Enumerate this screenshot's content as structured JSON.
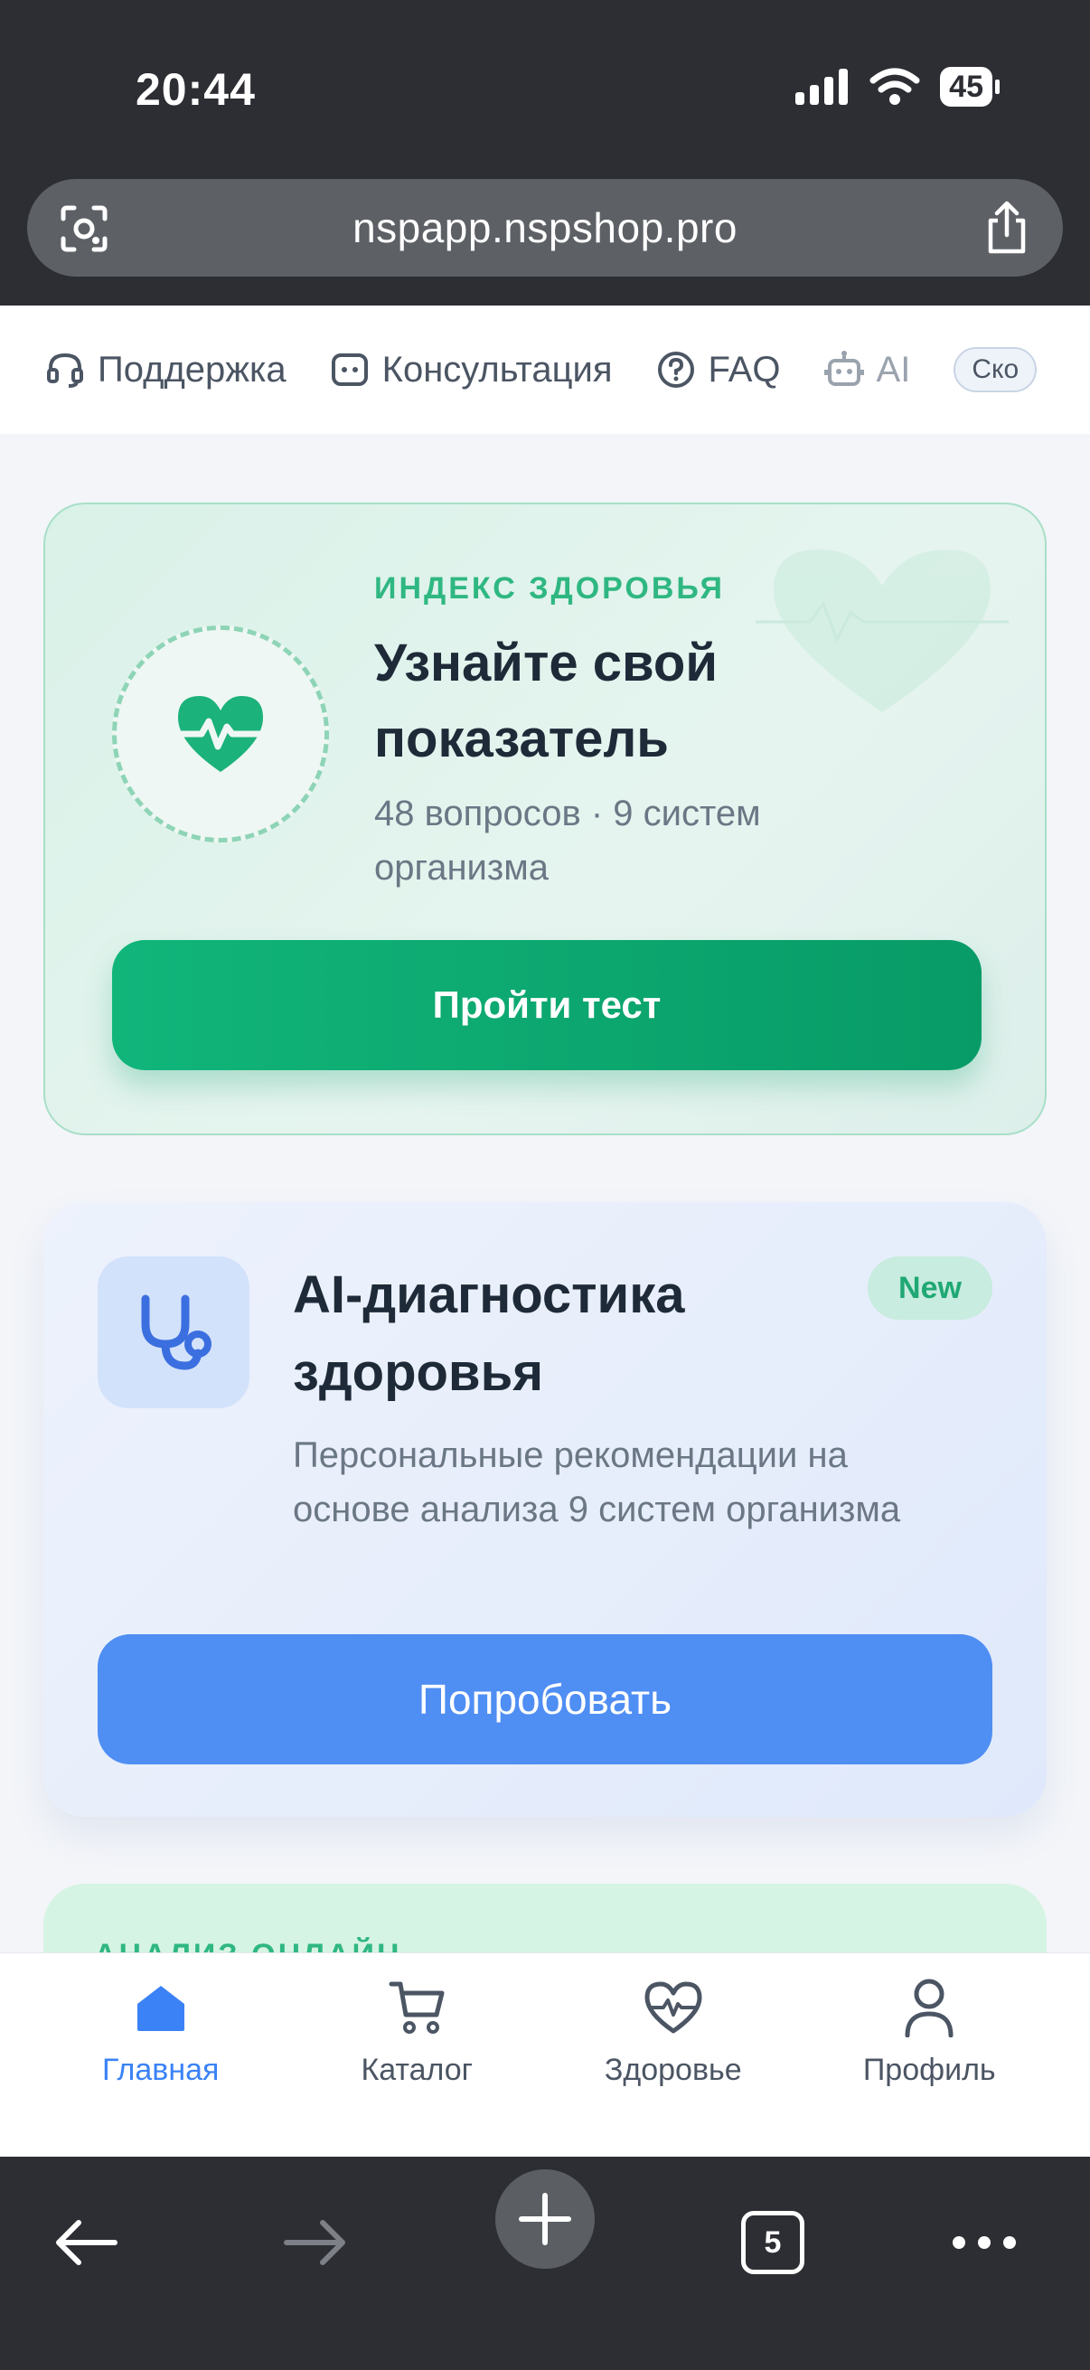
{
  "status": {
    "time": "20:44",
    "battery": "45"
  },
  "browser": {
    "url": "nspapp.nspshop.pro",
    "tabs_count": "5"
  },
  "topnav": {
    "items": [
      {
        "label": "Поддержка",
        "icon": "headset-icon"
      },
      {
        "label": "Консультация",
        "icon": "chat-icon"
      },
      {
        "label": "FAQ",
        "icon": "question-icon"
      },
      {
        "label": "AI",
        "icon": "robot-icon"
      }
    ],
    "chip": "Ско"
  },
  "health_card": {
    "overline": "ИНДЕКС ЗДОРОВЬЯ",
    "title": "Узнайте свой показатель",
    "subtitle": "48 вопросов · 9 систем организма",
    "button": "Пройти тест",
    "icon": "heart-pulse-icon"
  },
  "ai_card": {
    "title": "AI-диагностика здоровья",
    "badge": "New",
    "subtitle": "Персональные рекомендации на основе анализа 9 систем организма",
    "button": "Попробовать",
    "icon": "stethoscope-icon"
  },
  "next_card": {
    "overline": "АНАЛИЗ ОНЛАЙН"
  },
  "tabbar": {
    "items": [
      {
        "label": "Главная",
        "icon": "home-icon",
        "active": true
      },
      {
        "label": "Каталог",
        "icon": "cart-icon"
      },
      {
        "label": "Здоровье",
        "icon": "heart-icon"
      },
      {
        "label": "Профиль",
        "icon": "user-icon"
      }
    ]
  },
  "colors": {
    "green": "#11b57a",
    "blue": "#4f8ef3",
    "chrome": "#2c2e33"
  }
}
